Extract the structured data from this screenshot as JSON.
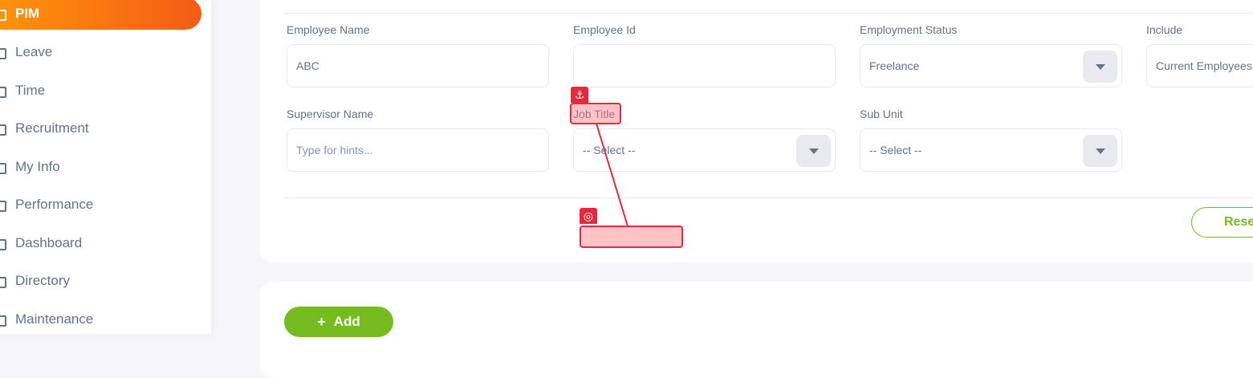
{
  "sidebar": {
    "items": [
      {
        "label": "PIM",
        "active": true
      },
      {
        "label": "Leave"
      },
      {
        "label": "Time"
      },
      {
        "label": "Recruitment"
      },
      {
        "label": "My Info"
      },
      {
        "label": "Performance"
      },
      {
        "label": "Dashboard"
      },
      {
        "label": "Directory"
      },
      {
        "label": "Maintenance"
      }
    ]
  },
  "filters": {
    "employee_name": {
      "label": "Employee Name",
      "value": "ABC"
    },
    "employee_id": {
      "label": "Employee Id",
      "value": ""
    },
    "employment_status": {
      "label": "Employment Status",
      "value": "Freelance"
    },
    "include": {
      "label": "Include",
      "value": "Current Employees"
    },
    "supervisor_name": {
      "label": "Supervisor Name",
      "placeholder": "Type for hints..."
    },
    "job_title": {
      "label": "Job Title",
      "value": "-- Select --"
    },
    "sub_unit": {
      "label": "Sub Unit",
      "value": "-- Select --"
    }
  },
  "actions": {
    "reset_label": "Reset",
    "add_label": "Add",
    "add_symbol": "+"
  },
  "annotations": {
    "anchor_icon": "anchor-icon",
    "target_icon": "target-icon",
    "anchor_glyph": "⚓",
    "target_glyph": "◎"
  },
  "colors": {
    "accent_orange": "#f35c17",
    "accent_green": "#76bc21",
    "annotation_red": "#e8283c"
  }
}
